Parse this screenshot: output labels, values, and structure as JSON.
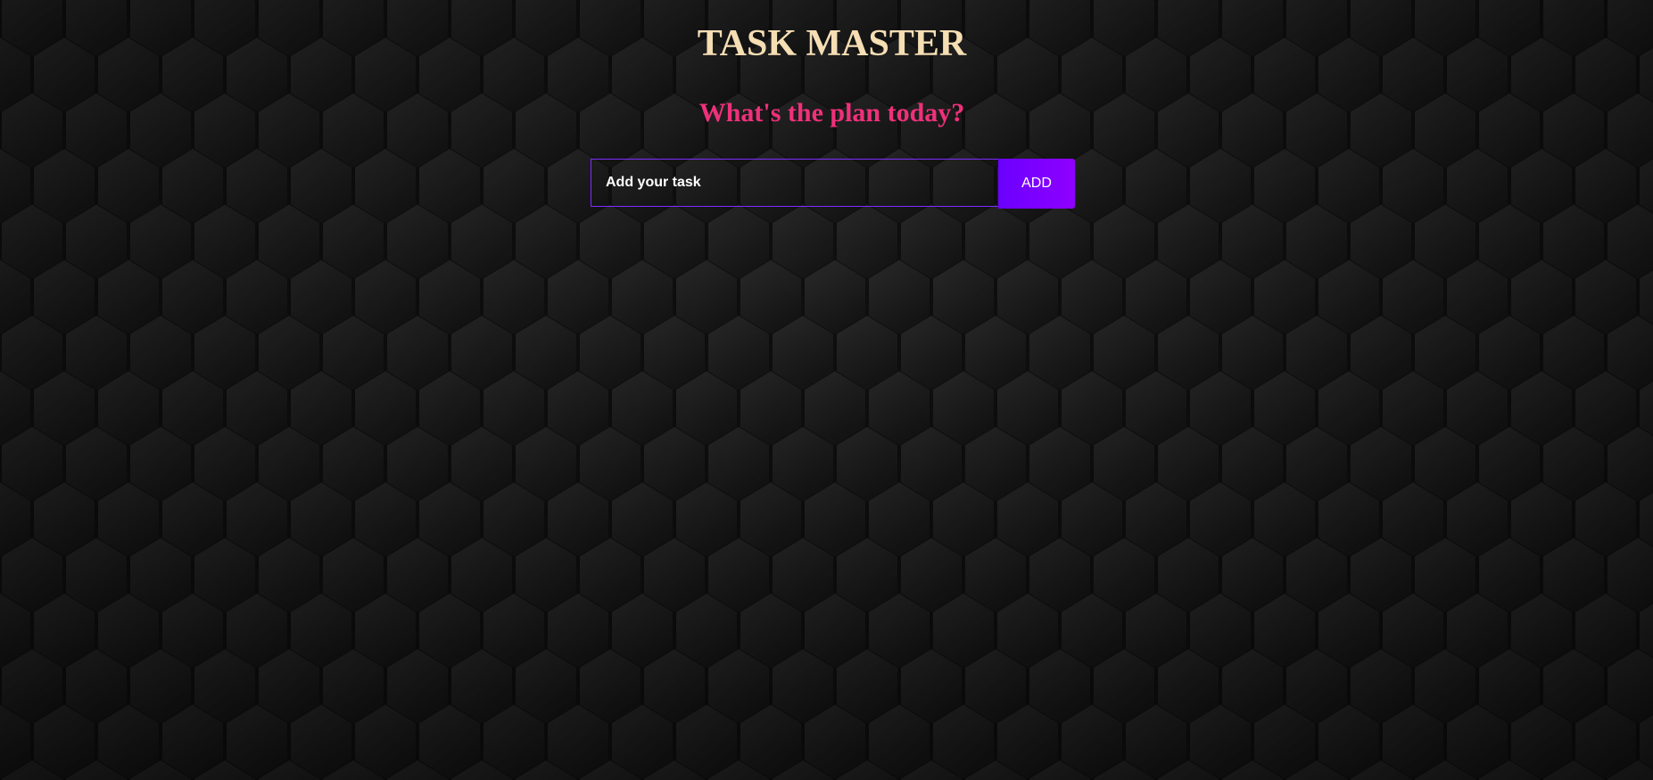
{
  "app": {
    "title": "TASK MASTER",
    "subtitle": "What's the plan today?"
  },
  "form": {
    "input_placeholder": "Add your task",
    "input_value": "",
    "add_label": "ADD"
  },
  "colors": {
    "title": "#f5deb3",
    "subtitle": "#f0307a",
    "accent": "#7b2cff",
    "button_start": "#6a00ff",
    "button_end": "#8f00ff",
    "background": "#1c1c1c",
    "hex_light": "#262626",
    "hex_dark": "#101010"
  }
}
